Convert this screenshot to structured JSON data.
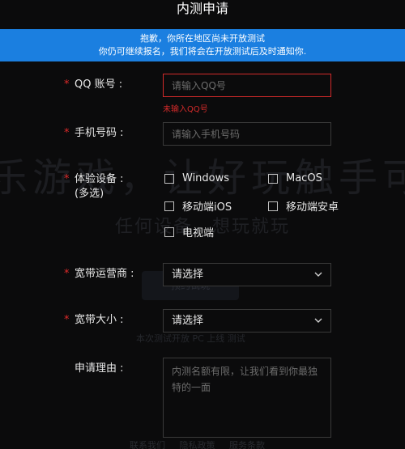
{
  "header": {
    "title": "内测申请"
  },
  "banner": {
    "line1": "抱歉，你所在地区尚未开放测试",
    "line2": "你仍可继续报名，我们将会在开放测试后及时通知你."
  },
  "background": {
    "headline": "乐游戏，让好玩触手可及",
    "subline": "任何设备，想玩就玩",
    "button": "预约试玩",
    "note": "本次测试开放 PC 上线 测试",
    "footer": "联系我们 隐私政策 服务条款"
  },
  "form": {
    "required_mark": "*",
    "qq": {
      "label": "QQ 账号 :",
      "placeholder": "请输入QQ号",
      "value": "",
      "error": "未输入QQ号"
    },
    "phone": {
      "label": "手机号码 :",
      "placeholder": "请输入手机号码",
      "value": ""
    },
    "device": {
      "label_line1": "体验设备 :",
      "label_line2": "(多选)",
      "options": [
        {
          "label": "Windows",
          "checked": false
        },
        {
          "label": "MacOS",
          "checked": false
        },
        {
          "label": "移动端iOS",
          "checked": false
        },
        {
          "label": "移动端安卓",
          "checked": false
        },
        {
          "label": "电视端",
          "checked": false
        }
      ]
    },
    "isp": {
      "label": "宽带运营商 :",
      "selected": "请选择"
    },
    "bandwidth": {
      "label": "宽带大小 :",
      "selected": "请选择"
    },
    "reason": {
      "label": "申请理由 :",
      "placeholder": "内测名额有限，让我们看到你最独特的一面",
      "value": ""
    }
  },
  "icons": {
    "chevron": "chevron-down-icon",
    "resize": "resize-grip-icon"
  },
  "colors": {
    "background": "#0b0b0c",
    "banner": "#1b7fe0",
    "required": "#e02a2a",
    "error": "#d22a2a",
    "border": "#3a3a3a",
    "text": "#e8e8e8",
    "placeholder": "#6c6c6c"
  }
}
